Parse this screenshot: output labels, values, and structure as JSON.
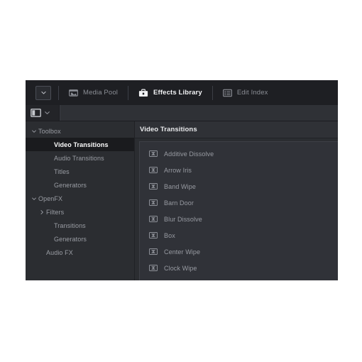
{
  "window": {
    "tabbar": {
      "panel_menu_button": {
        "icon": "chevron-down-icon"
      },
      "tabs": [
        {
          "label": "Media Pool",
          "icon": "media-pool-icon",
          "active": false
        },
        {
          "label": "Effects Library",
          "icon": "effects-library-icon",
          "active": true
        },
        {
          "label": "Edit Index",
          "icon": "edit-index-icon",
          "active": false
        }
      ]
    },
    "subbar": {
      "layout_button": {
        "icon": "panel-layout-icon"
      },
      "layout_dropdown": {
        "icon": "chevron-down-icon"
      }
    },
    "sidebar": {
      "items": [
        {
          "label": "Toolbox",
          "twisty": "chevron-down-icon",
          "indent": 0,
          "selected": false
        },
        {
          "label": "Video Transitions",
          "twisty": "",
          "indent": 2,
          "selected": true
        },
        {
          "label": "Audio Transitions",
          "twisty": "",
          "indent": 2,
          "selected": false
        },
        {
          "label": "Titles",
          "twisty": "",
          "indent": 2,
          "selected": false
        },
        {
          "label": "Generators",
          "twisty": "",
          "indent": 2,
          "selected": false
        },
        {
          "label": "OpenFX",
          "twisty": "chevron-down-icon",
          "indent": 0,
          "selected": false
        },
        {
          "label": "Filters",
          "twisty": "chevron-right-icon",
          "indent": 1,
          "selected": false
        },
        {
          "label": "Transitions",
          "twisty": "",
          "indent": 2,
          "selected": false
        },
        {
          "label": "Generators",
          "twisty": "",
          "indent": 2,
          "selected": false
        },
        {
          "label": "Audio FX",
          "twisty": "",
          "indent": 1,
          "selected": false
        }
      ]
    },
    "content": {
      "header_title": "Video Transitions",
      "items": [
        {
          "label": "Additive Dissolve",
          "icon": "transition-icon"
        },
        {
          "label": "Arrow Iris",
          "icon": "transition-icon"
        },
        {
          "label": "Band Wipe",
          "icon": "transition-icon"
        },
        {
          "label": "Barn Door",
          "icon": "transition-icon"
        },
        {
          "label": "Blur Dissolve",
          "icon": "transition-icon"
        },
        {
          "label": "Box",
          "icon": "transition-icon"
        },
        {
          "label": "Center Wipe",
          "icon": "transition-icon"
        },
        {
          "label": "Clock Wipe",
          "icon": "transition-icon"
        }
      ]
    }
  },
  "colors": {
    "page_background": "#ffffff",
    "window_background": "#2b2d31",
    "tabbar_background": "#1e1f23",
    "selected_row": "#1a1b1e",
    "text_muted": "#989ba2",
    "text_active": "#ffffff"
  }
}
